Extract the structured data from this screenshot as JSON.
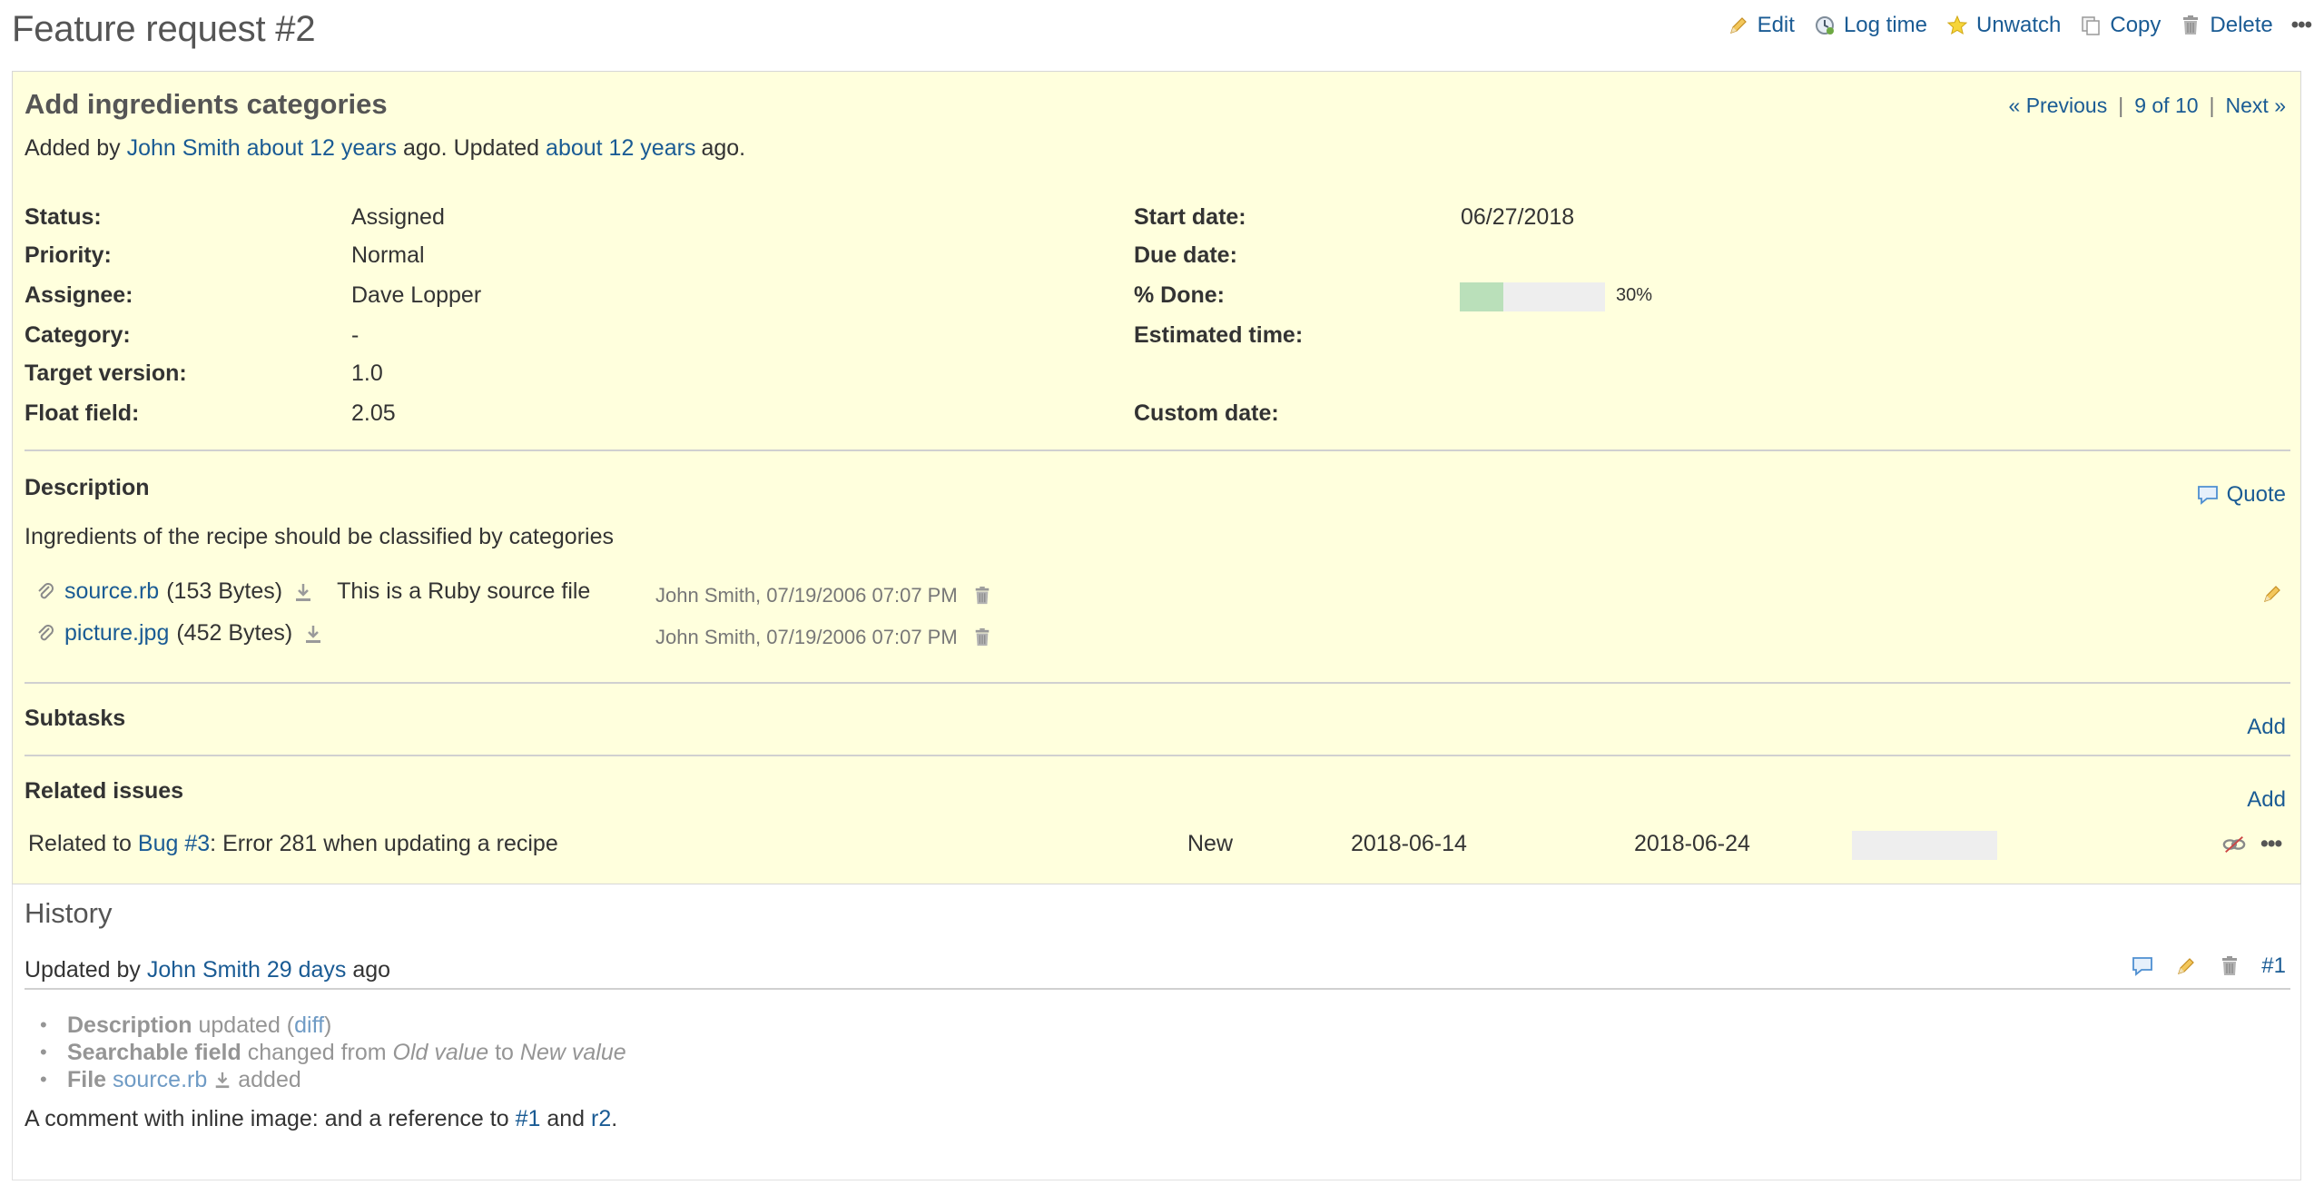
{
  "page": {
    "title": "Feature request #2"
  },
  "contextual": {
    "edit": "Edit",
    "log_time": "Log time",
    "unwatch": "Unwatch",
    "copy": "Copy",
    "delete": "Delete",
    "more": "•••"
  },
  "issue": {
    "subject": "Add ingredients categories",
    "added_by_prefix": "Added by",
    "author": "John Smith",
    "created_ago": "about 12 years",
    "updated_prefix": "ago. Updated",
    "updated_ago": "about 12 years",
    "suffix": "ago.",
    "nav": {
      "previous": "« Previous",
      "position": "9 of 10",
      "next": "Next »",
      "sep": "|"
    }
  },
  "attributes": {
    "status_label": "Status:",
    "status": "Assigned",
    "priority_label": "Priority:",
    "priority": "Normal",
    "assignee_label": "Assignee:",
    "assignee": "Dave Lopper",
    "category_label": "Category:",
    "category": "-",
    "target_version_label": "Target version:",
    "target_version": "1.0",
    "float_field_label": "Float field:",
    "float_field": "2.05",
    "start_date_label": "Start date:",
    "start_date": "06/27/2018",
    "due_date_label": "Due date:",
    "due_date": "",
    "done_label": "% Done:",
    "done_percent_text": "30%",
    "done_fraction": 0.3,
    "estimated_time_label": "Estimated time:",
    "estimated_time": "",
    "custom_date_label": "Custom date:",
    "custom_date": ""
  },
  "description": {
    "title": "Description",
    "quote": "Quote",
    "text": "Ingredients of the recipe should be classified by categories"
  },
  "attachments": [
    {
      "name": "source.rb",
      "size": "(153 Bytes)",
      "description": "This is a Ruby source file",
      "meta": "John Smith, 07/19/2006 07:07 PM"
    },
    {
      "name": "picture.jpg",
      "size": "(452 Bytes)",
      "description": "",
      "meta": "John Smith, 07/19/2006 07:07 PM"
    }
  ],
  "subtasks": {
    "title": "Subtasks",
    "add": "Add"
  },
  "relations": {
    "title": "Related issues",
    "add": "Add",
    "rows": [
      {
        "relation": "Related to",
        "issue_link": "Bug #3",
        "subject": ": Error 281 when updating a recipe",
        "status": "New",
        "start": "2018-06-14",
        "due": "2018-06-24",
        "done_fraction": 0
      }
    ]
  },
  "history": {
    "title": "History",
    "updated_by_prefix": "Updated by",
    "author": "John Smith",
    "ago": "29 days",
    "ago_suffix": "ago",
    "journal_id": "#1",
    "details": [
      {
        "field": "Description",
        "text_before": "updated (",
        "link": "diff",
        "text_after": ")"
      },
      {
        "field": "Searchable field",
        "text1": "changed from",
        "old": "Old value",
        "text2": "to",
        "new": "New value"
      },
      {
        "field": "File",
        "link": "source.rb",
        "text_after": "added"
      }
    ],
    "comment": {
      "prefix": "A comment with inline image:  and a reference to",
      "ref1": "#1",
      "mid": "and",
      "ref2": "r2",
      "end": "."
    }
  },
  "colors": {
    "link": "#1a5b94",
    "issue_bg": "#ffffdd",
    "progress_done": "#bae0ba",
    "progress_todo": "#eeeeee"
  },
  "icons": [
    "pencil-icon",
    "clock-icon",
    "star-icon",
    "copy-icon",
    "trash-icon",
    "more-icon",
    "paperclip-icon",
    "download-icon",
    "comment-icon",
    "unlink-icon"
  ]
}
